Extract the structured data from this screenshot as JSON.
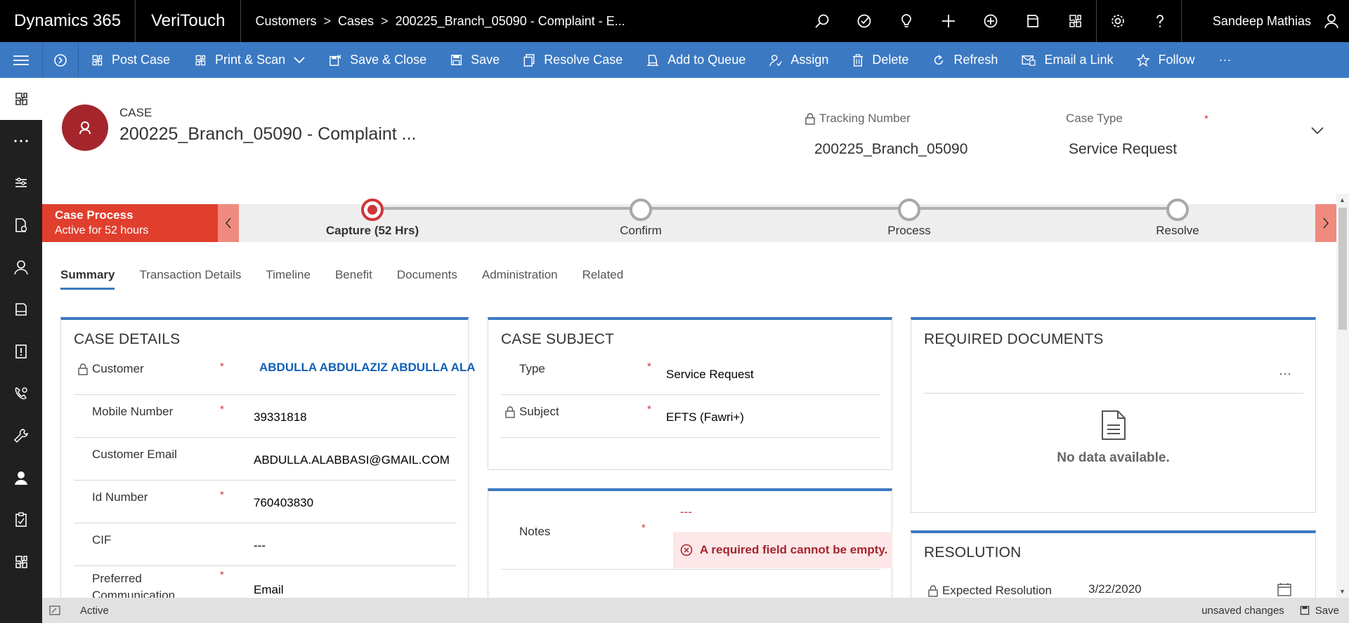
{
  "topbar": {
    "brand": "Dynamics 365",
    "app": "VeriTouch",
    "breadcrumb": [
      "Customers",
      "Cases",
      "200225_Branch_05090 - Complaint - E..."
    ],
    "separator": ">",
    "user": "Sandeep Mathias",
    "icons": [
      "search-icon",
      "task-icon",
      "lightbulb-icon",
      "plus-icon",
      "add-circle-icon",
      "filter-icon",
      "puzzle-icon",
      "gear-icon",
      "help-icon",
      "user-icon"
    ]
  },
  "commands": [
    {
      "label": "Post Case",
      "icon": "puzzle-icon"
    },
    {
      "label": "Print & Scan",
      "icon": "puzzle-icon"
    },
    {
      "label": "Save & Close",
      "icon": "save-close-icon"
    },
    {
      "label": "Save",
      "icon": "save-icon"
    },
    {
      "label": "Resolve Case",
      "icon": "resolve-icon"
    },
    {
      "label": "Add to Queue",
      "icon": "queue-icon"
    },
    {
      "label": "Assign",
      "icon": "assign-icon"
    },
    {
      "label": "Delete",
      "icon": "delete-icon"
    },
    {
      "label": "Refresh",
      "icon": "refresh-icon"
    },
    {
      "label": "Email a Link",
      "icon": "email-icon"
    },
    {
      "label": "Follow",
      "icon": "star-icon"
    }
  ],
  "more_label": "···",
  "header": {
    "entity": "CASE",
    "title": "200225_Branch_05090 - Complaint ...",
    "tracking_label": "Tracking Number",
    "tracking_value": "200225_Branch_05090",
    "casetype_label": "Case Type",
    "casetype_value": "Service Request",
    "required_mark": "*"
  },
  "process": {
    "name": "Case Process",
    "duration": "Active for 52 hours",
    "stages": [
      {
        "label": "Capture  (52 Hrs)",
        "active": true
      },
      {
        "label": "Confirm",
        "active": false
      },
      {
        "label": "Process",
        "active": false
      },
      {
        "label": "Resolve",
        "active": false
      }
    ]
  },
  "tabs": [
    "Summary",
    "Transaction Details",
    "Timeline",
    "Benefit",
    "Documents",
    "Administration",
    "Related"
  ],
  "case_details": {
    "title": "CASE DETAILS",
    "fields": [
      {
        "label": "Customer",
        "value": "ABDULLA ABDULAZIZ ABDULLA ALABBASI",
        "required": "*"
      },
      {
        "label": "Mobile Number",
        "value": "39331818",
        "required": "*"
      },
      {
        "label": "Customer Email",
        "value": "ABDULLA.ALABBASI@GMAIL.COM",
        "required": ""
      },
      {
        "label": "Id Number",
        "value": "760403830",
        "required": "*"
      },
      {
        "label": "CIF",
        "value": "---",
        "required": ""
      },
      {
        "label": "Preferred Communication",
        "value": "Email",
        "required": "*"
      }
    ]
  },
  "case_subject": {
    "title": "CASE SUBJECT",
    "fields": [
      {
        "label": "Type",
        "value": "Service Request",
        "required": "*"
      },
      {
        "label": "Subject",
        "value": "EFTS (Fawri+)",
        "required": "*"
      }
    ]
  },
  "notes": {
    "label": "Notes",
    "value": "---",
    "required": "*",
    "error": "A required field cannot be empty."
  },
  "required_documents": {
    "title": "REQUIRED DOCUMENTS",
    "more": "···",
    "empty": "No data available."
  },
  "resolution": {
    "title": "RESOLUTION",
    "field_label": "Expected Resolution",
    "field_value": "3/22/2020"
  },
  "status": {
    "state": "Active",
    "unsaved": "unsaved changes",
    "save": "Save"
  }
}
